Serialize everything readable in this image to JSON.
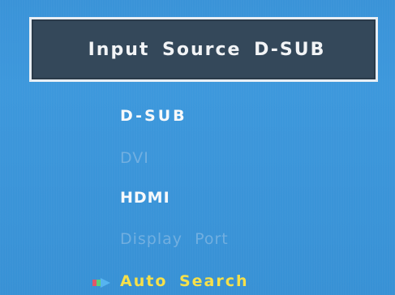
{
  "osd": {
    "title": "Input Source D-SUB",
    "items": [
      {
        "label": "D-SUB",
        "state": "enabled"
      },
      {
        "label": "DVI",
        "state": "disabled"
      },
      {
        "label": "HDMI",
        "state": "enabled"
      },
      {
        "label": "Display Port",
        "state": "disabled"
      },
      {
        "label": "Auto Search",
        "state": "selected"
      }
    ],
    "selection_icon": "arrow-right-icon",
    "colors": {
      "background": "#3b95d9",
      "title_bg": "#34485a",
      "title_border": "#e8eef4",
      "text": "#f7f9fb",
      "disabled_text": "#7fb6e3",
      "selected_text": "#f6e04a"
    }
  }
}
